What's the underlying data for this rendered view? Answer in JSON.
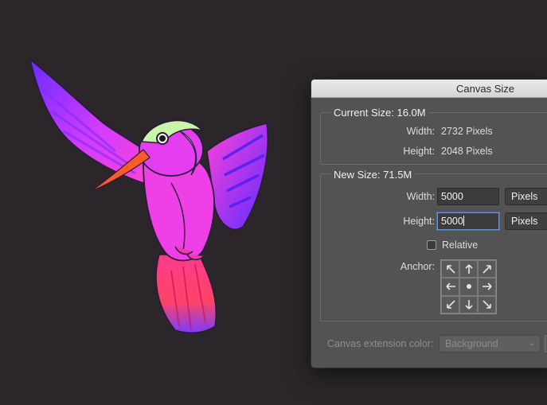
{
  "dialog": {
    "title": "Canvas Size",
    "current_size": {
      "legend": "Current Size: 16.0M",
      "width_label": "Width:",
      "width_value": "2732 Pixels",
      "height_label": "Height:",
      "height_value": "2048 Pixels"
    },
    "new_size": {
      "legend": "New Size: 71.5M",
      "width_label": "Width:",
      "width_value": "5000",
      "width_unit": "Pixels",
      "height_label": "Height:",
      "height_value": "5000",
      "height_unit": "Pixels",
      "relative_label": "Relative",
      "relative_checked": false,
      "anchor_label": "Anchor:"
    },
    "extension_color_label": "Canvas extension color:",
    "extension_color_value": "Background"
  },
  "anchor_icons": [
    "arrow-up-left-icon",
    "arrow-up-icon",
    "arrow-up-right-icon",
    "arrow-left-icon",
    "center-dot-icon",
    "arrow-right-icon",
    "arrow-down-left-icon",
    "arrow-down-icon",
    "arrow-down-right-icon"
  ],
  "colors": {
    "canvas_bg": "#2a2629",
    "dialog_bg": "#535353",
    "focus_ring": "#6f8fd8"
  }
}
